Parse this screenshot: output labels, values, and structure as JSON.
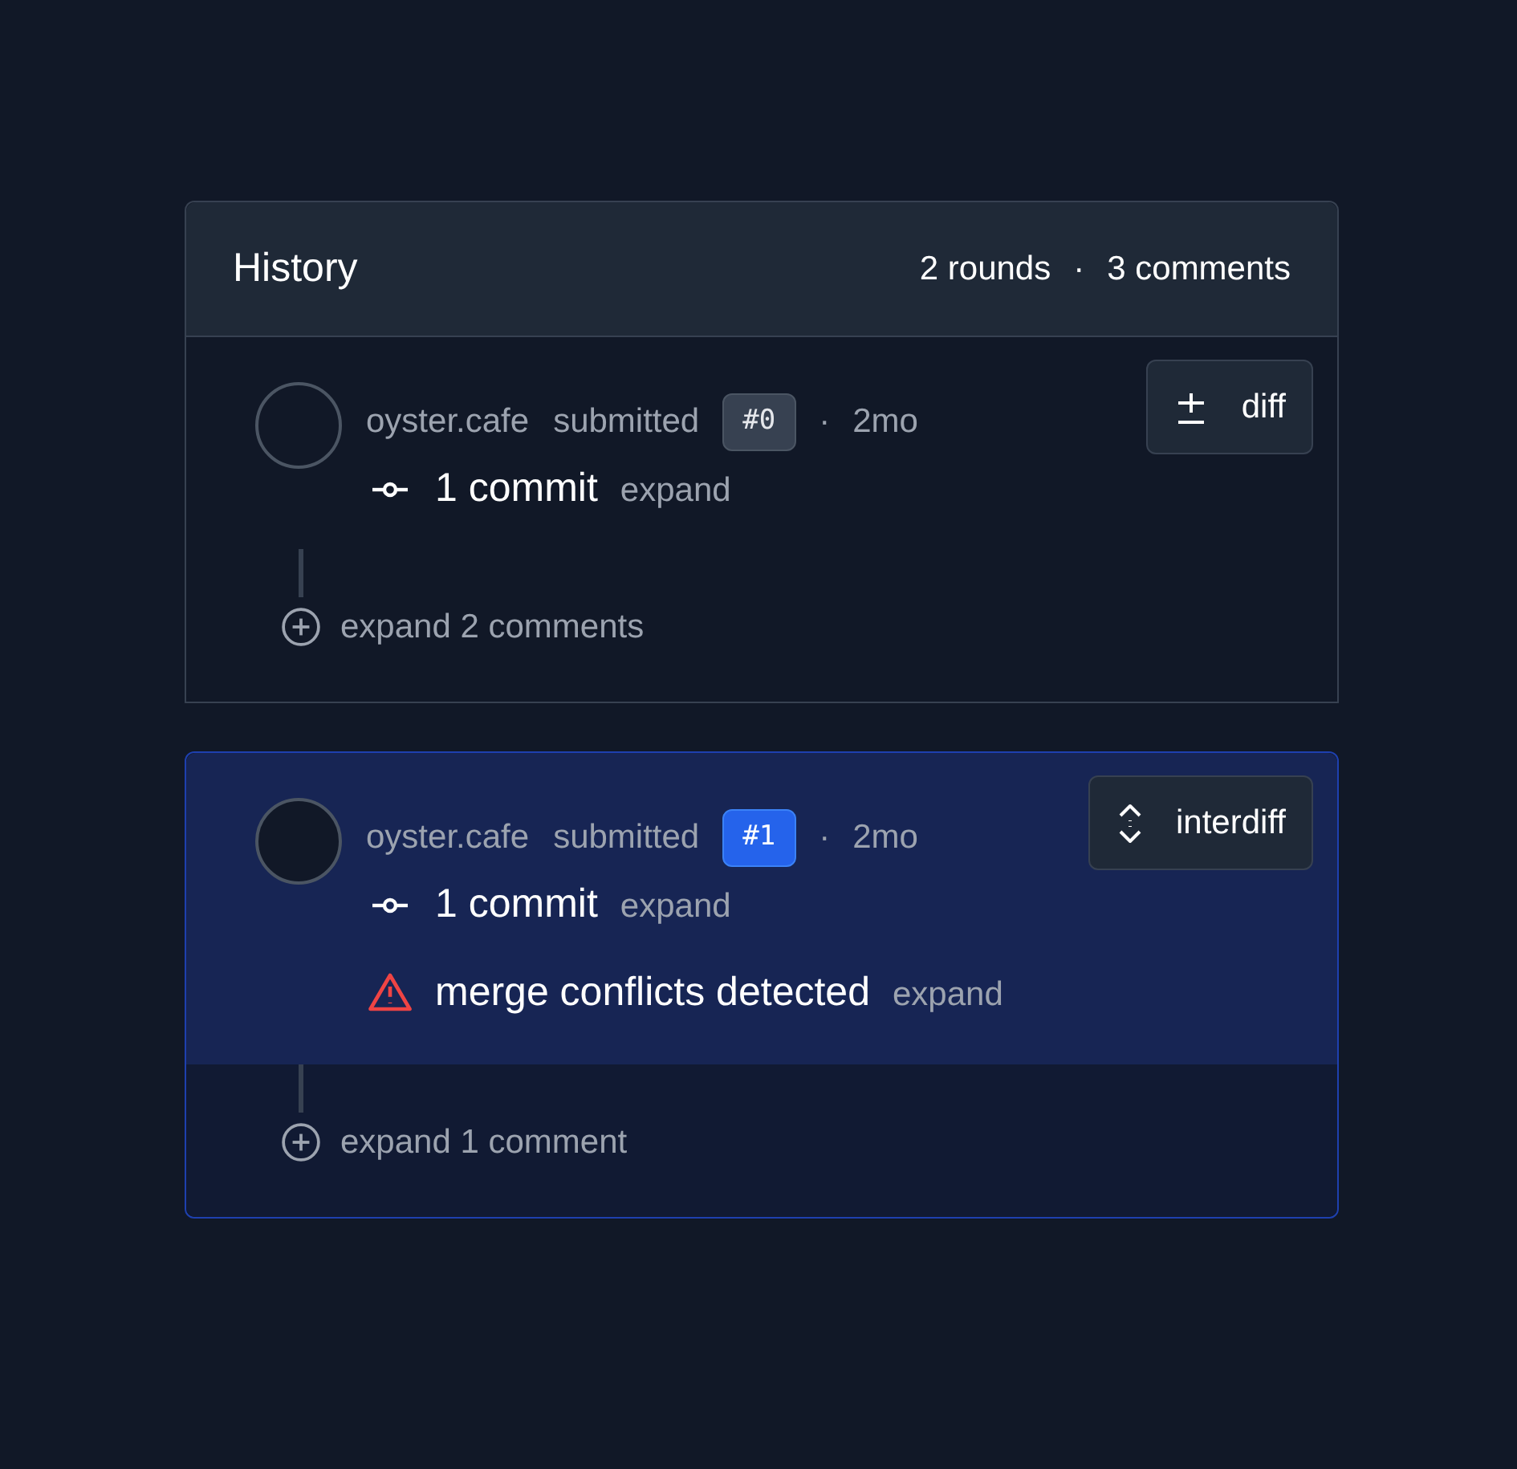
{
  "history": {
    "title": "History",
    "rounds_count": "2 rounds",
    "separator": "·",
    "comments_count": "3 comments"
  },
  "rounds": [
    {
      "selected": false,
      "author": "oyster.cafe",
      "action": "submitted",
      "badge": "#0",
      "dot": "·",
      "age": "2mo",
      "button": {
        "kind": "diff",
        "label": "diff"
      },
      "items": [
        {
          "kind": "commit",
          "text": "1 commit",
          "link": "expand"
        }
      ],
      "comments": "expand 2 comments"
    },
    {
      "selected": true,
      "author": "oyster.cafe",
      "action": "submitted",
      "badge": "#1",
      "dot": "·",
      "age": "2mo",
      "button": {
        "kind": "interdiff",
        "label": "interdiff"
      },
      "items": [
        {
          "kind": "commit",
          "text": "1 commit",
          "link": "expand"
        },
        {
          "kind": "conflict",
          "text": "merge conflicts detected",
          "link": "expand"
        }
      ],
      "comments": "expand 1 comment"
    }
  ]
}
